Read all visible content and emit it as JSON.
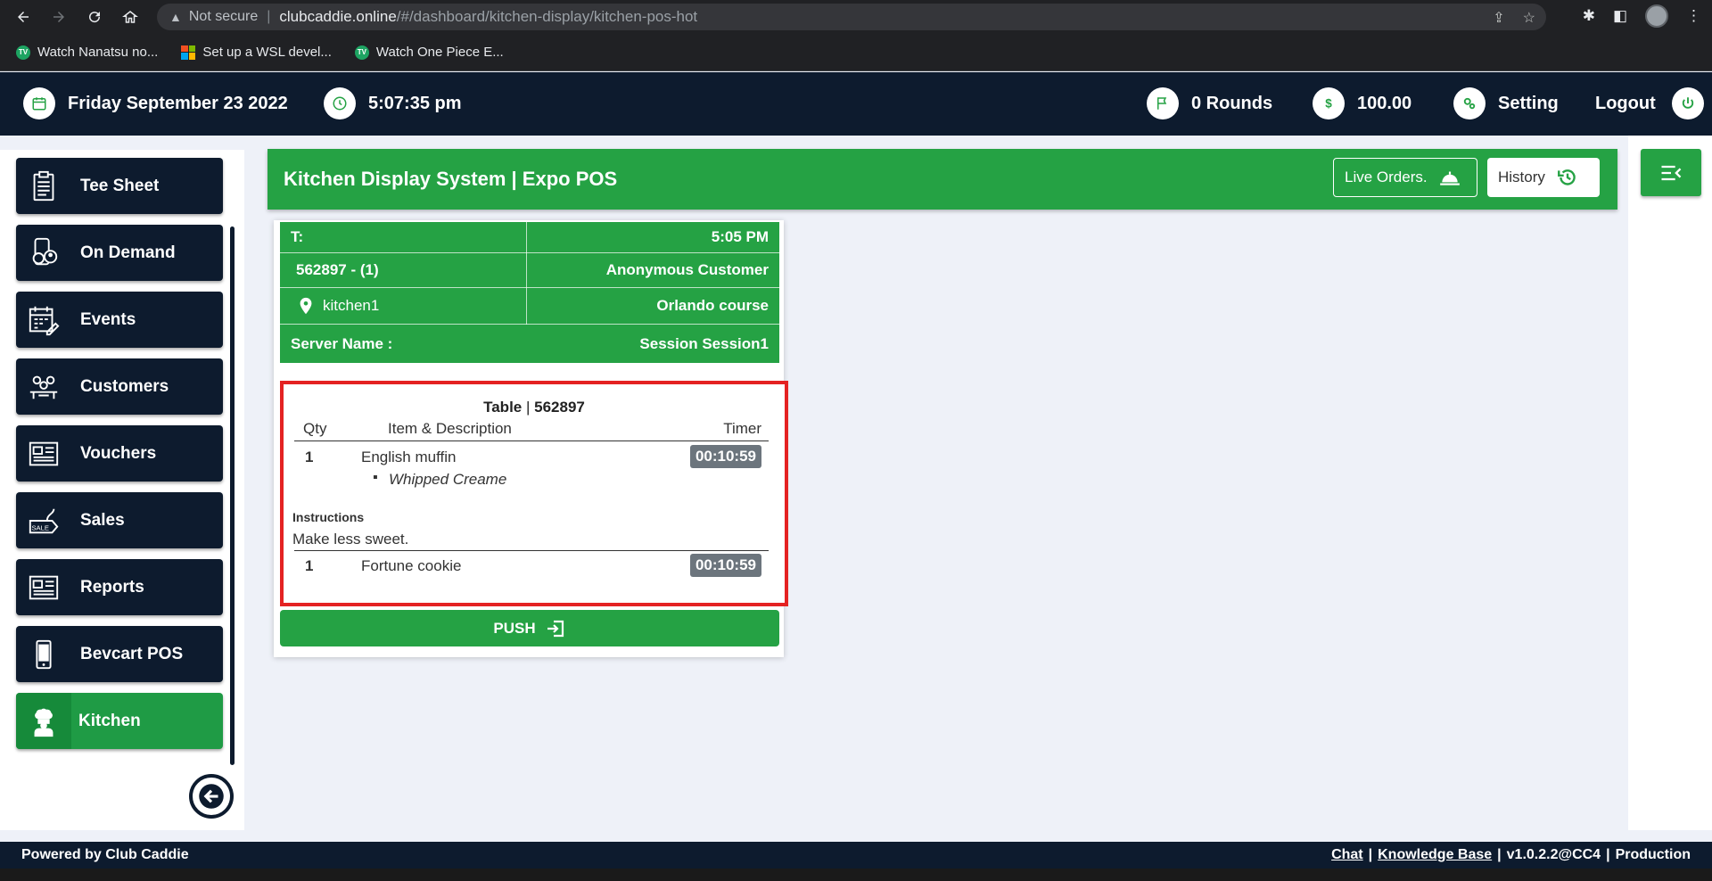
{
  "browser": {
    "warning": "Not secure",
    "url_host": "clubcaddie.online",
    "url_path": "/#/dashboard/kitchen-display/kitchen-pos-hot",
    "bookmarks": [
      {
        "label": "Watch Nanatsu no...",
        "icon": "tv-icon"
      },
      {
        "label": "Set up a WSL devel...",
        "icon": "microsoft-icon"
      },
      {
        "label": "Watch One Piece E...",
        "icon": "tv-icon"
      }
    ]
  },
  "header": {
    "date": "Friday September 23 2022",
    "time": "5:07:35 pm",
    "rounds": "0 Rounds",
    "balance": "100.00",
    "setting": "Setting",
    "logout": "Logout"
  },
  "sidebar": {
    "items": [
      {
        "label": "Tee Sheet",
        "icon": "clipboard-icon"
      },
      {
        "label": "On Demand",
        "icon": "phone-person-icon"
      },
      {
        "label": "Events",
        "icon": "calendar-edit-icon"
      },
      {
        "label": "Customers",
        "icon": "customers-icon"
      },
      {
        "label": "Vouchers",
        "icon": "voucher-icon"
      },
      {
        "label": "Sales",
        "icon": "sale-tag-icon"
      },
      {
        "label": "Reports",
        "icon": "report-icon"
      },
      {
        "label": "Bevcart POS",
        "icon": "mobile-icon"
      },
      {
        "label": "Kitchen",
        "icon": "chef-icon",
        "active": true
      }
    ]
  },
  "main": {
    "title": "Kitchen Display System | Expo POS",
    "live_orders": "Live Orders.",
    "history": "History"
  },
  "ticket": {
    "t_label": "T:",
    "time": "5:05 PM",
    "order_id": "562897 - (1)",
    "customer": "Anonymous Customer",
    "location": "kitchen1",
    "course": "Orlando course",
    "server_label": "Server Name :",
    "session": "Session Session1",
    "table_label": "Table",
    "table_sep": "|",
    "table_number": "562897",
    "col_qty": "Qty",
    "col_item": "Item & Description",
    "col_timer": "Timer",
    "items": [
      {
        "qty": "1",
        "name": "English muffin",
        "modifier": "Whipped Creame",
        "timer": "00:10:59"
      },
      {
        "qty": "1",
        "name": "Fortune cookie",
        "timer": "00:10:59"
      }
    ],
    "instructions_label": "Instructions",
    "instructions": "Make less sweet.",
    "push": "PUSH"
  },
  "footer": {
    "powered": "Powered by Club Caddie",
    "chat": "Chat",
    "kb": "Knowledge Base",
    "version": "v1.0.2.2@CC4",
    "env": "Production",
    "sep": "|"
  },
  "colors": {
    "navy": "#0d1b2e",
    "green": "#25a244",
    "highlight": "#e42222"
  }
}
